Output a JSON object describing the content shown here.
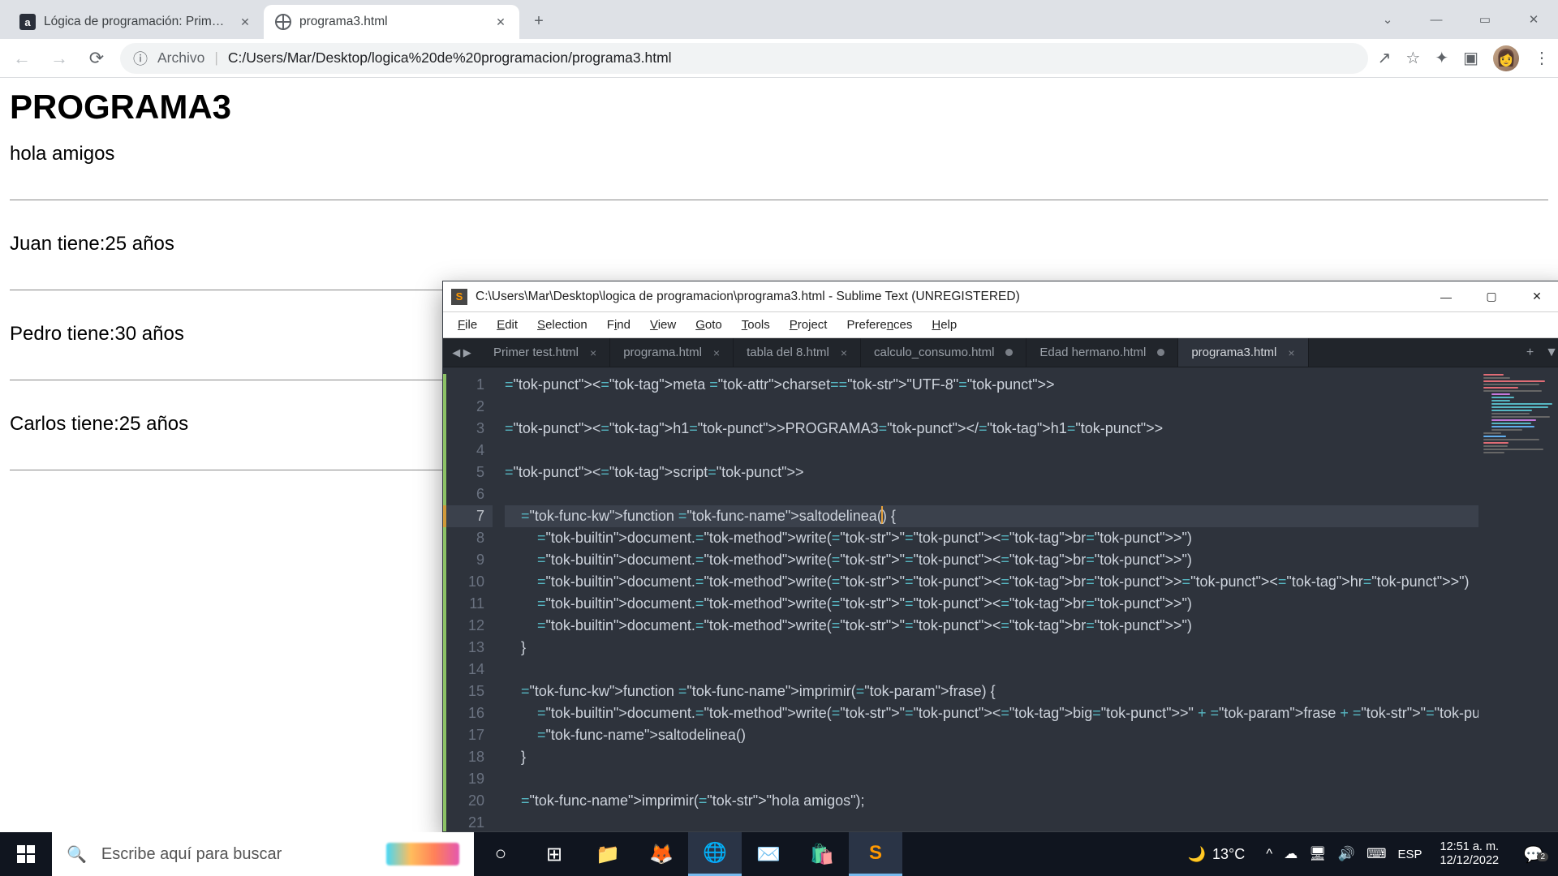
{
  "chrome": {
    "tabs": [
      {
        "title": "Lógica de programación: Primero",
        "favicon": "a",
        "active": false
      },
      {
        "title": "programa3.html",
        "favicon": "globe",
        "active": true
      }
    ],
    "window_controls": {
      "dropdown": "⌄",
      "minimize": "—",
      "maximize": "▭",
      "close": "✕"
    },
    "toolbar": {
      "back": "←",
      "forward": "→",
      "reload": "⟳",
      "info_icon": "ⓘ",
      "url_label": "Archivo",
      "url_path": "C:/Users/Mar/Desktop/logica%20de%20programacion/programa3.html",
      "share": "↗",
      "star": "☆",
      "extensions": "✦",
      "sidepanel": "▣",
      "menu": "⋮"
    }
  },
  "page": {
    "heading": "PROGRAMA3",
    "lines": [
      "hola amigos",
      "Juan tiene:25 años",
      "Pedro tiene:30 años",
      "Carlos tiene:25 años"
    ]
  },
  "sublime": {
    "title": "C:\\Users\\Mar\\Desktop\\logica de programacion\\programa3.html - Sublime Text (UNREGISTERED)",
    "menu": [
      "File",
      "Edit",
      "Selection",
      "Find",
      "View",
      "Goto",
      "Tools",
      "Project",
      "Preferences",
      "Help"
    ],
    "tabs": [
      {
        "name": "Primer test.html",
        "state": "close"
      },
      {
        "name": "programa.html",
        "state": "close"
      },
      {
        "name": "tabla del 8.html",
        "state": "close"
      },
      {
        "name": "calculo_consumo.html",
        "state": "dirty"
      },
      {
        "name": "Edad hermano.html",
        "state": "dirty"
      },
      {
        "name": "programa3.html",
        "state": "close",
        "active": true
      }
    ],
    "code_lines": [
      "<meta charset=\"UTF-8\">",
      "",
      "<h1>PROGRAMA3</h1>",
      "",
      "<script>",
      "",
      "    function saltodelinea() {",
      "        document.write(\"<br>\")",
      "        document.write(\"<br>\")",
      "        document.write(\"<br><hr>\")",
      "        document.write(\"<br>\")",
      "        document.write(\"<br>\")",
      "    }",
      "",
      "    function imprimir(frase) {",
      "        document.write(\"<big>\" + frase + \"</big>\")",
      "        saltodelinea()",
      "    }",
      "",
      "    imprimir(\"hola amigos\");",
      ""
    ],
    "active_line": 7
  },
  "taskbar": {
    "search_placeholder": "Escribe aquí para buscar",
    "weather_temp": "13°C",
    "lang": "ESP",
    "time": "12:51 a. m.",
    "date": "12/12/2022",
    "notif_count": "2"
  }
}
